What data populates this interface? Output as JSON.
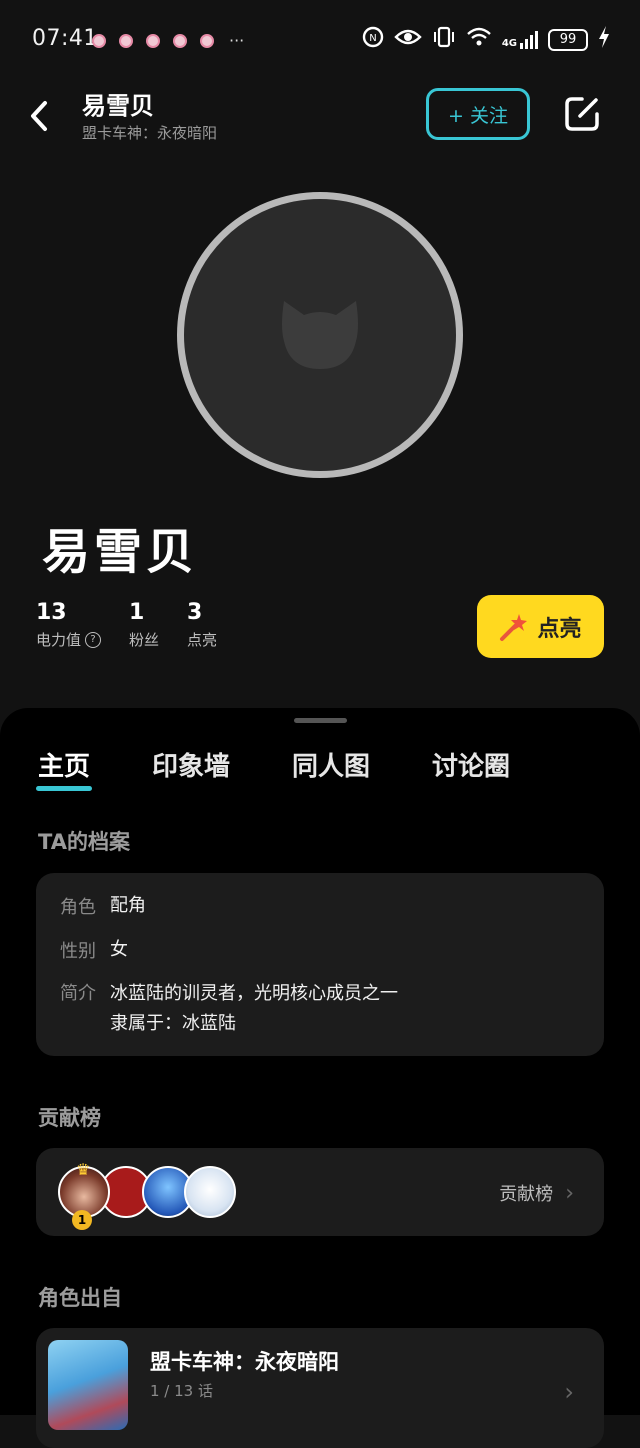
{
  "status": {
    "time": "07:41",
    "more": "···",
    "network": "4G",
    "battery": "99"
  },
  "header": {
    "title": "易雪贝",
    "subtitle": "盟卡车神：永夜暗阳",
    "follow_label": "+ 关注"
  },
  "profile": {
    "name": "易雪贝",
    "stats": [
      {
        "value": "13",
        "label": "电力值"
      },
      {
        "value": "1",
        "label": "粉丝"
      },
      {
        "value": "3",
        "label": "点亮"
      }
    ],
    "light_button": "点亮"
  },
  "tabs": [
    "主页",
    "印象墙",
    "同人图",
    "讨论圈"
  ],
  "archive": {
    "title": "TA的档案",
    "rows": [
      {
        "key": "角色",
        "value": "配角"
      },
      {
        "key": "性别",
        "value": "女"
      },
      {
        "key": "简介",
        "value": "冰蓝陆的训灵者，光明核心成员之一",
        "value2": "隶属于：冰蓝陆"
      }
    ]
  },
  "contribution": {
    "title": "贡献榜",
    "link_label": "贡献榜",
    "first_rank": "1"
  },
  "source": {
    "title": "角色出自",
    "work_title": "盟卡车神：永夜暗阳",
    "episodes": "1 / 13 话"
  },
  "colors": {
    "accent": "#39c6d4",
    "light_button": "#ffd91f",
    "background": "#121212"
  }
}
